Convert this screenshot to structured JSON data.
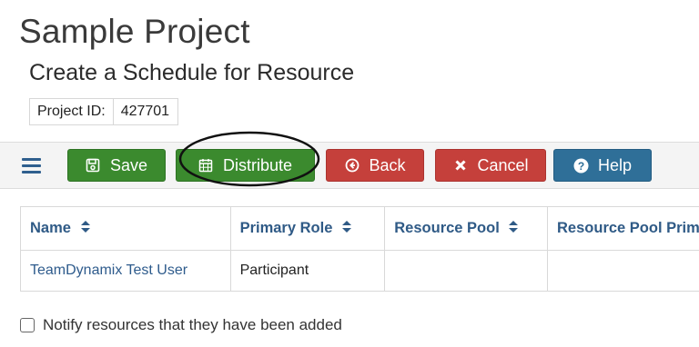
{
  "header": {
    "project_title": "Sample Project",
    "page_subtitle": "Create a Schedule for Resource",
    "project_id_label": "Project ID:",
    "project_id_value": "427701"
  },
  "toolbar": {
    "menu_icon": "hamburger-icon",
    "buttons": [
      {
        "label": "Save",
        "icon": "save-icon",
        "color": "#3b8a2e"
      },
      {
        "label": "Distribute",
        "icon": "calendar-icon",
        "color": "#3b8a2e"
      },
      {
        "label": "Back",
        "icon": "circle-arrow-left-icon",
        "color": "#c5403b"
      },
      {
        "label": "Cancel",
        "icon": "x-icon",
        "color": "#c5403b"
      },
      {
        "label": "Help",
        "icon": "question-circle-icon",
        "color": "#2f6f98"
      }
    ]
  },
  "table": {
    "columns": [
      "Name",
      "Primary Role",
      "Resource Pool",
      "Resource Pool Prim"
    ],
    "rows": [
      [
        "TeamDynamix Test User",
        "Participant",
        "",
        ""
      ]
    ]
  },
  "notify": {
    "label": "Notify resources that they have been added",
    "checked": false
  },
  "colors": {
    "accent_green": "#3b8a2e",
    "accent_red": "#c5403b",
    "accent_blue": "#2f6f98",
    "link_blue": "#2e5b8c"
  }
}
